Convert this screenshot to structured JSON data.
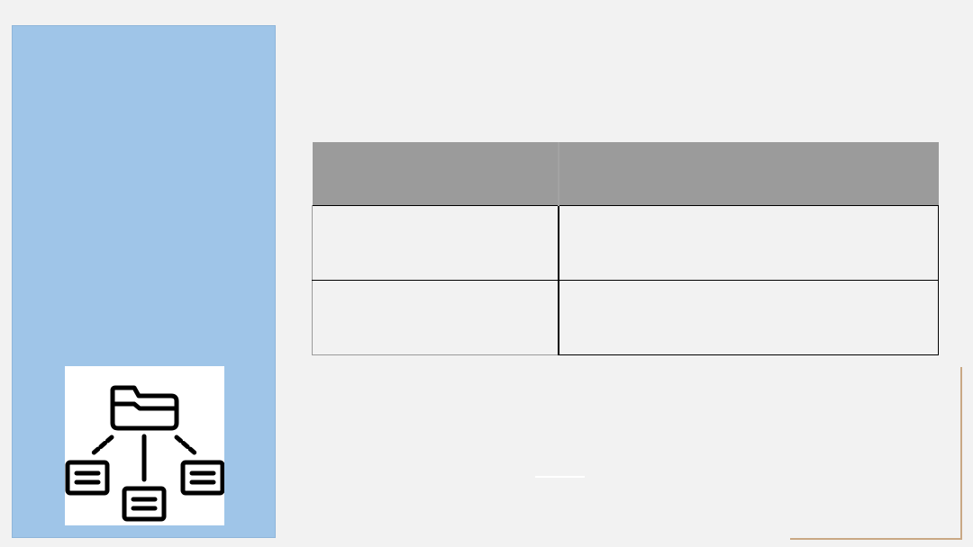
{
  "slide": {
    "background_color": "#f2f2f2",
    "side_panel_color": "#9fc5e8",
    "accent_color": "#c9a884"
  },
  "icon": {
    "name": "folder-network-icon"
  },
  "table": {
    "header_color": "#9b9b9b",
    "headers": [
      "",
      ""
    ],
    "rows": [
      [
        "",
        ""
      ],
      [
        "",
        ""
      ]
    ]
  }
}
